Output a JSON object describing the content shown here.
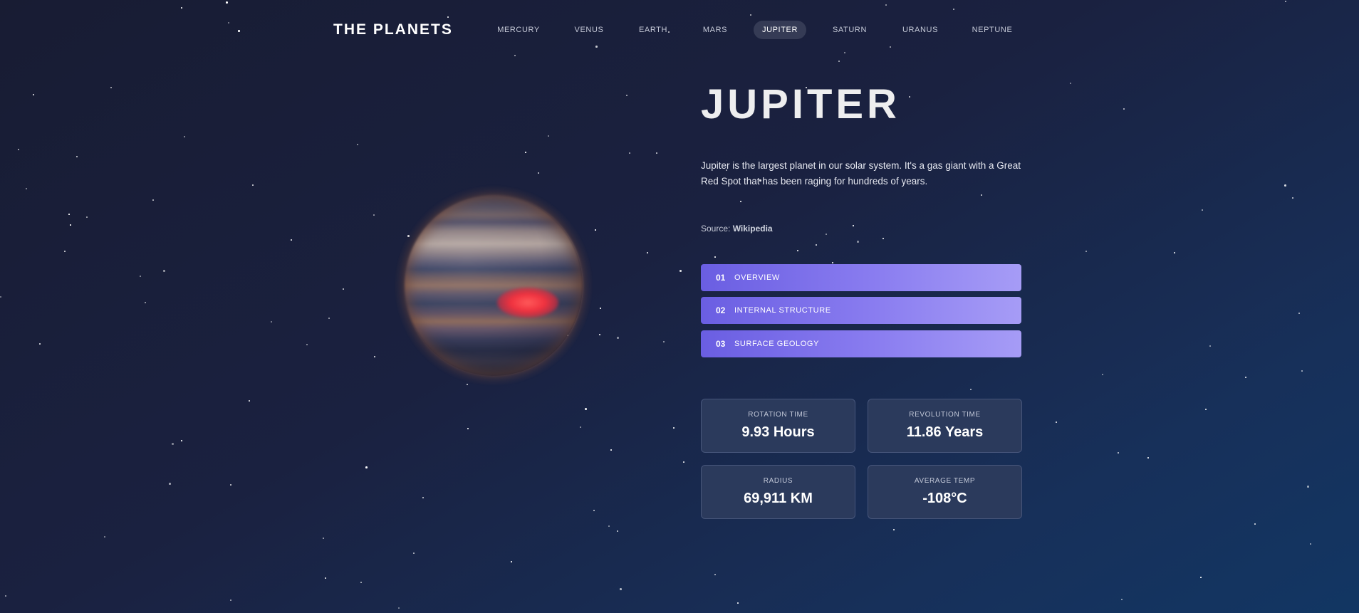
{
  "header": {
    "logo": "THE PLANETS",
    "nav": [
      {
        "label": "MERCURY",
        "active": false
      },
      {
        "label": "VENUS",
        "active": false
      },
      {
        "label": "EARTH",
        "active": false
      },
      {
        "label": "MARS",
        "active": false
      },
      {
        "label": "JUPITER",
        "active": true
      },
      {
        "label": "SATURN",
        "active": false
      },
      {
        "label": "URANUS",
        "active": false
      },
      {
        "label": "NEPTUNE",
        "active": false
      }
    ]
  },
  "planet": {
    "name": "JUPITER",
    "description": "Jupiter is the largest planet in our solar system. It's a gas giant with a Great Red Spot that has been raging for hundreds of years.",
    "source_prefix": "Source:",
    "source_link": "Wikipedia"
  },
  "tabs": [
    {
      "number": "01",
      "label": "OVERVIEW"
    },
    {
      "number": "02",
      "label": "INTERNAL STRUCTURE"
    },
    {
      "number": "03",
      "label": "SURFACE GEOLOGY"
    }
  ],
  "stats": [
    {
      "label": "ROTATION TIME",
      "value": "9.93 Hours"
    },
    {
      "label": "REVOLUTION TIME",
      "value": "11.86 Years"
    },
    {
      "label": "RADIUS",
      "value": "69,911 KM"
    },
    {
      "label": "AVERAGE TEMP",
      "value": "-108°C"
    }
  ],
  "colors": {
    "background": "#1a2140",
    "tab_accent_start": "#6a5ee2",
    "tab_accent_end": "#a69cf6",
    "great_red_spot": "#f0323f",
    "nav_active_bg": "#353b55"
  }
}
